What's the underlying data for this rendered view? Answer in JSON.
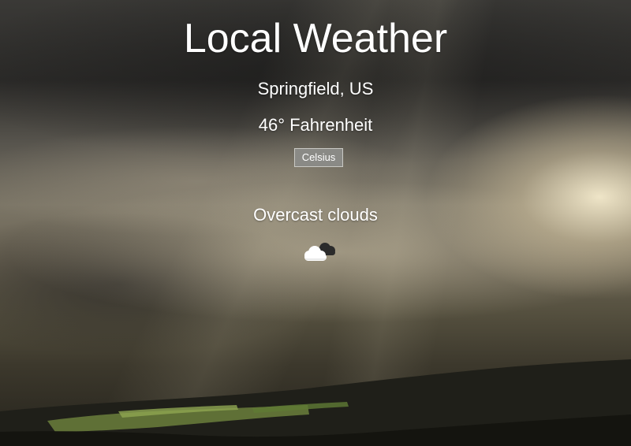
{
  "app": {
    "title": "Local Weather"
  },
  "weather": {
    "location": "Springfield, US",
    "temperature": "46° Fahrenheit",
    "unit_toggle_label": "Celsius",
    "condition": "Overcast clouds",
    "icon": "overcast-clouds-icon"
  }
}
